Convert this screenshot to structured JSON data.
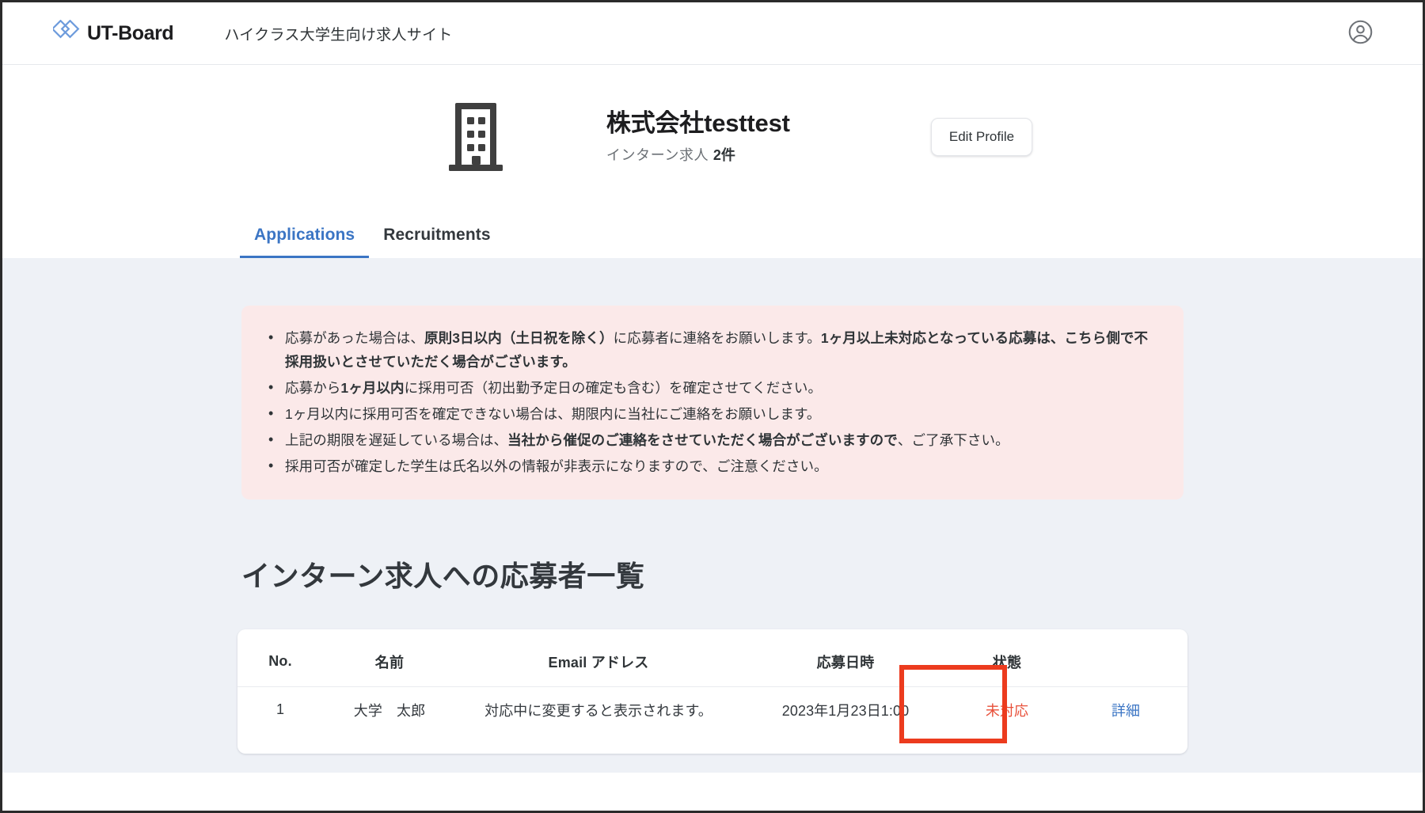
{
  "header": {
    "brand_name": "UT-Board",
    "brand_logo_icon": "ut-board-diamond-logo",
    "tagline": "ハイクラス大学生向け求人サイト",
    "account_icon": "account-circle-icon"
  },
  "profile": {
    "company_icon": "building-icon",
    "company_name": "株式会社testtest",
    "sub_label": "インターン求人",
    "sub_count": "2件",
    "edit_button_label": "Edit Profile"
  },
  "tabs": [
    {
      "label": "Applications",
      "active": true
    },
    {
      "label": "Recruitments",
      "active": false
    }
  ],
  "notice": {
    "bullets": [
      "応募があった場合は、<b>原則3日以内（土日祝を除く）</b>に応募者に連絡をお願いします。<b>1ヶ月以上未対応となっている応募は、こちら側で不採用扱いとさせていただく場合がございます。</b>",
      "応募から<b>1ヶ月以内</b>に採用可否（初出勤予定日の確定も含む）を確定させてください。",
      "1ヶ月以内に採用可否を確定できない場合は、期限内に当社にご連絡をお願いします。",
      "上記の期限を遅延している場合は、<b>当社から催促のご連絡をさせていただく場合がございますので</b>、ご了承下さい。",
      "採用可否が確定した学生は氏名以外の情報が非表示になりますので、ご注意ください。"
    ]
  },
  "main": {
    "section_title": "インターン求人への応募者一覧",
    "table": {
      "columns": [
        "No.",
        "名前",
        "Email アドレス",
        "応募日時",
        "状態",
        ""
      ],
      "rows": [
        {
          "no": "1",
          "name": "大学　太郎",
          "email": "対応中に変更すると表示されます。",
          "applied_at": "2023年1月23日1:00",
          "status": "未対応",
          "action_label": "詳細"
        }
      ]
    }
  },
  "annotation": {
    "highlight_color": "#ec3b1e",
    "target": "詳細"
  },
  "colors": {
    "accent_blue": "#3b75c4",
    "status_red": "#e8503a",
    "notice_bg": "#fbe9e9",
    "page_bg": "#eef1f6"
  }
}
